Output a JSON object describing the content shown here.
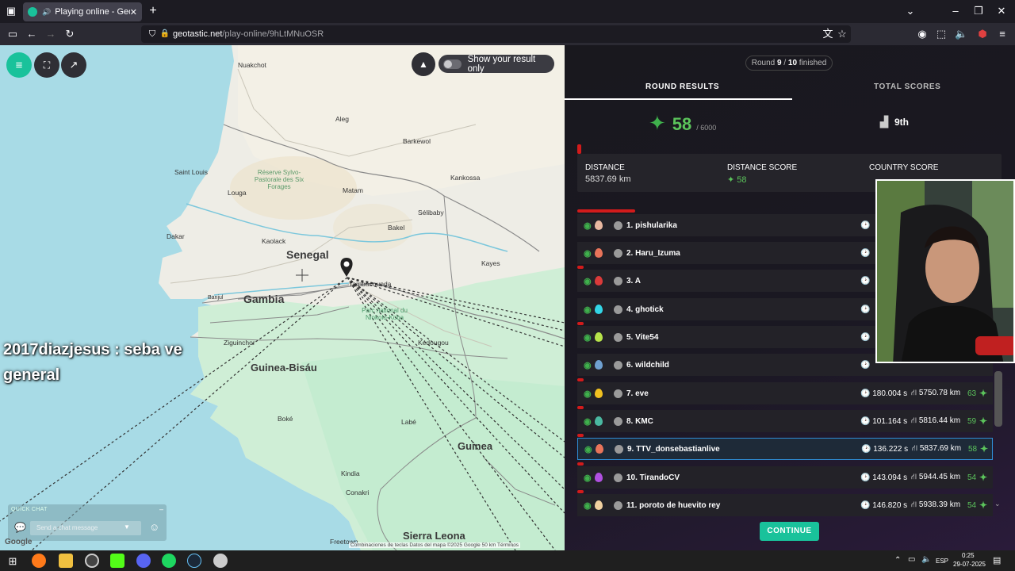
{
  "browser": {
    "tab_title": "Playing online - Geotastic",
    "url_host": "geotastic.net",
    "url_path": "/play-online/9hLtMNuOSR"
  },
  "map": {
    "toggle_label": "Show your result only",
    "countries": [
      "Senegal",
      "Gambia",
      "Guinea-Bisáu",
      "Guinea",
      "Sierra Leona"
    ],
    "cities": [
      "Nuakchot",
      "Saint Louis",
      "Dakar",
      "Banjul",
      "Ziguinchor",
      "Conakri",
      "Freetown",
      "Matam",
      "Louga",
      "Kayes",
      "Sélibaby",
      "Bakel",
      "Kankossa",
      "Barkewol",
      "Aleg",
      "Kaolack",
      "Tambacounda",
      "Kédougou",
      "Labé",
      "Kindia",
      "Boké"
    ],
    "reserve_label": "Réserve Sylvo-Pastorale des Six Forages",
    "park_label": "Parc national du Niokolo-Koba",
    "chat_message_line1": "2017diazjesus : seba ve",
    "chat_message_line2": "general",
    "quickchat_header": "QUICK CHAT",
    "quickchat_placeholder": "Send a chat message",
    "attribution": "Combinaciones de teclas   Datos del mapa ©2025 Google   50 km   Términos",
    "google": "Google"
  },
  "results": {
    "round_prefix": "Round ",
    "round_current": "9",
    "round_sep": " / ",
    "round_total": "10",
    "round_suffix": " finished",
    "tab_round": "ROUND RESULTS",
    "tab_total": "TOTAL SCORES",
    "score": "58",
    "score_max": "/ 6000",
    "rank": "9th",
    "distance_label": "DISTANCE",
    "distance_value": "5837.69 km",
    "distance_score_label": "DISTANCE SCORE",
    "distance_score_value": "58",
    "country_score_label": "COUNTRY SCORE",
    "continue_label": "CONTINUE"
  },
  "players": [
    {
      "rank": "1. pishularika",
      "time": "",
      "dist": "",
      "pts": "",
      "pin": "#e8b8a0"
    },
    {
      "rank": "2. Haru_Izuma",
      "time": "",
      "dist": "",
      "pts": "",
      "pin": "#e8745a"
    },
    {
      "rank": "3. A",
      "time": "",
      "dist": "",
      "pts": "",
      "pin": "#d93a3a"
    },
    {
      "rank": "4. ghotick",
      "time": "",
      "dist": "",
      "pts": "",
      "pin": "#33d6e6"
    },
    {
      "rank": "5. Vite54",
      "time": "",
      "dist": "",
      "pts": "",
      "pin": "#b7e34a"
    },
    {
      "rank": "6. wildchild",
      "time": "",
      "dist": "",
      "pts": "",
      "pin": "#6fa0d0"
    },
    {
      "rank": "7. eve",
      "time": "180.004 s",
      "dist": "5750.78 km",
      "pts": "63",
      "pin": "#f0c020"
    },
    {
      "rank": "8. KMC",
      "time": "101.164 s",
      "dist": "5816.44 km",
      "pts": "59",
      "pin": "#4ab8a0"
    },
    {
      "rank": "9. TTV_donsebastianlive",
      "time": "136.222 s",
      "dist": "5837.69 km",
      "pts": "58",
      "pin": "#e8745a"
    },
    {
      "rank": "10. TirandoCV",
      "time": "143.094 s",
      "dist": "5944.45 km",
      "pts": "54",
      "pin": "#b050e0"
    },
    {
      "rank": "11. poroto de huevito rey",
      "time": "146.820 s",
      "dist": "5938.39 km",
      "pts": "54",
      "pin": "#f0d0a0"
    }
  ],
  "taskbar": {
    "lang": "ESP",
    "time": "0:25",
    "date": "29-07-2025"
  }
}
